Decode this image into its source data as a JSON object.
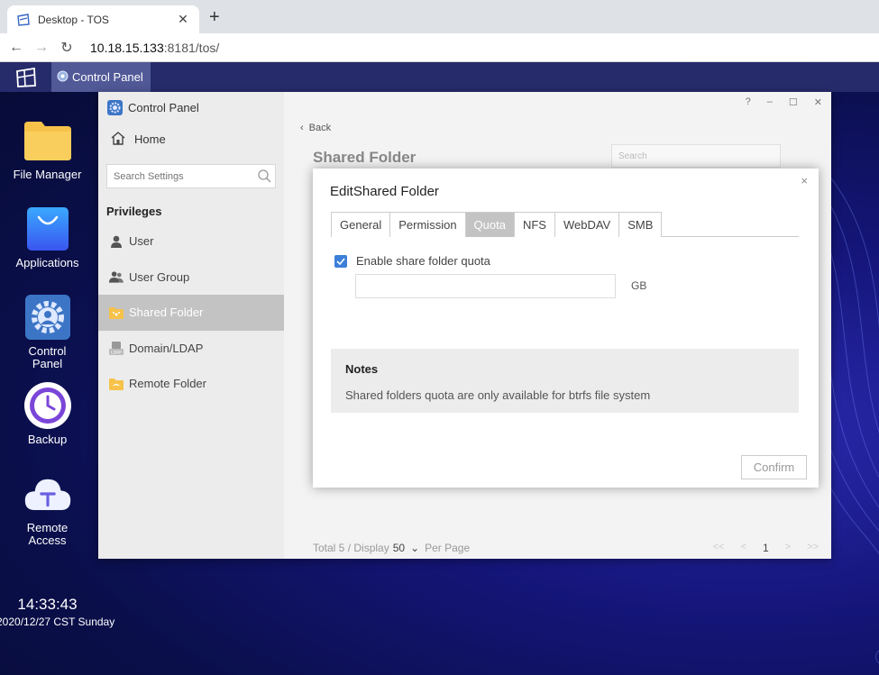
{
  "browser": {
    "tab_title": "Desktop - TOS",
    "tab_close": "✕",
    "new_tab": "+",
    "url_host": "10.18.15.133",
    "url_rest": ":8181/tos/"
  },
  "taskbar": {
    "active_app": "Control Panel"
  },
  "desktop_icons": [
    {
      "label": "File Manager"
    },
    {
      "label": "Applications"
    },
    {
      "label": "Control Panel"
    },
    {
      "label": "Backup"
    },
    {
      "label": "Remote Access"
    }
  ],
  "clock": {
    "time": "14:33:43",
    "date": "2020/12/27 CST Sunday"
  },
  "control_panel": {
    "header": "Control Panel",
    "home": "Home",
    "search_placeholder": "Search Settings",
    "section": "Privileges",
    "items": [
      {
        "label": "User"
      },
      {
        "label": "User Group"
      },
      {
        "label": "Shared Folder"
      },
      {
        "label": "Domain/LDAP"
      },
      {
        "label": "Remote Folder"
      }
    ],
    "window_controls": [
      "?",
      "–",
      "☐",
      "✕"
    ],
    "back": "Back",
    "title": "Shared Folder",
    "search_placeholder_main": "Search",
    "footer_total": "Total 5 / Display",
    "footer_display": "50",
    "footer_per_page": "Per Page",
    "pager": [
      "<<",
      "<",
      "1",
      ">",
      ">>"
    ]
  },
  "dialog": {
    "title": "EditShared Folder",
    "close": "×",
    "tabs": [
      "General",
      "Permission",
      "Quota",
      "NFS",
      "WebDAV",
      "SMB"
    ],
    "active_tab": "Quota",
    "checkbox_label": "Enable share folder quota",
    "checkbox_checked": true,
    "quota_value": "",
    "unit": "GB",
    "notes_title": "Notes",
    "notes_text": "Shared folders quota are only available for btrfs file system",
    "confirm": "Confirm"
  },
  "colors": {
    "accent_blue": "#3c7fd8",
    "active_gray": "#c3c3c3",
    "folder_yellow": "#f6c24a"
  }
}
